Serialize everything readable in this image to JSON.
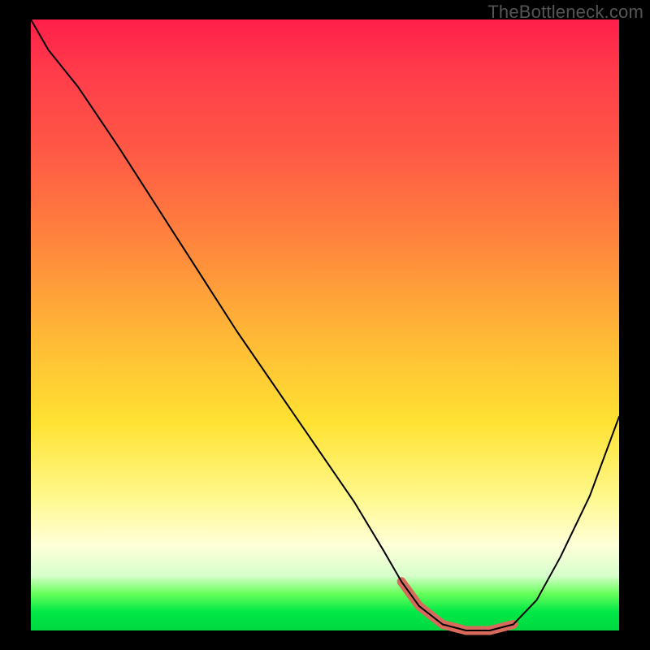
{
  "watermark": "TheBottleneck.com",
  "colors": {
    "frame_bg": "#000000",
    "curve": "#000000",
    "highlight": "#d86a5c",
    "gradient_stops": [
      "#ff1f4a",
      "#ff5a45",
      "#ff8a3c",
      "#ffb936",
      "#ffe232",
      "#fff88a",
      "#ffffd8",
      "#66ff5a",
      "#00d83f"
    ]
  },
  "chart_data": {
    "type": "line",
    "title": "",
    "xlabel": "",
    "ylabel": "",
    "xlim": [
      0,
      100
    ],
    "ylim": [
      0,
      100
    ],
    "x": [
      0,
      3,
      8,
      15,
      25,
      35,
      45,
      55,
      60,
      63,
      66,
      70,
      74,
      78,
      82,
      86,
      90,
      95,
      100
    ],
    "values": [
      100,
      95,
      89,
      79,
      64,
      49,
      35,
      21,
      13,
      8,
      4,
      1,
      0,
      0,
      1,
      5,
      12,
      22,
      35
    ],
    "series": [
      {
        "name": "bottleneck-curve",
        "x": [
          0,
          3,
          8,
          15,
          25,
          35,
          45,
          55,
          60,
          63,
          66,
          70,
          74,
          78,
          82,
          86,
          90,
          95,
          100
        ],
        "values": [
          100,
          95,
          89,
          79,
          64,
          49,
          35,
          21,
          13,
          8,
          4,
          1,
          0,
          0,
          1,
          5,
          12,
          22,
          35
        ]
      },
      {
        "name": "optimal-zone-highlight",
        "x": [
          63,
          66,
          70,
          74,
          78,
          82
        ],
        "values": [
          8,
          4,
          1,
          0,
          0,
          1
        ]
      }
    ],
    "annotations": []
  }
}
